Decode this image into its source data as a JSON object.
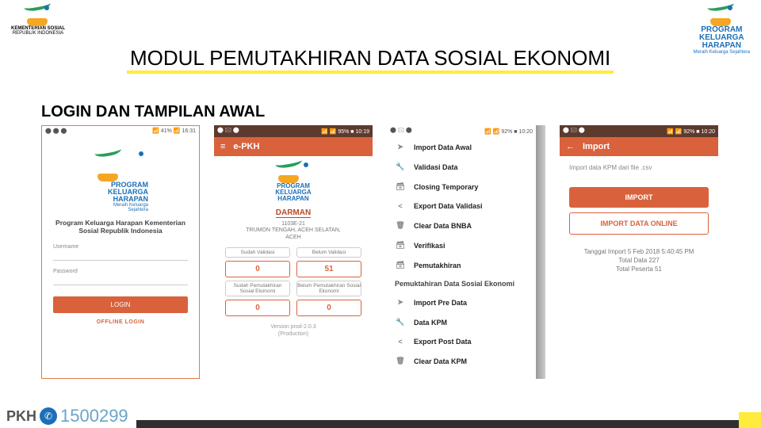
{
  "header": {
    "title": "MODUL PEMUTAKHIRAN DATA SOSIAL EKONOMI",
    "section": "LOGIN DAN TAMPILAN AWAL",
    "left_logo_caption1": "KEMENTERIAN SOSIAL",
    "left_logo_caption2": "REPUBLIK INDONESIA",
    "right_logo_line1": "PROGRAM",
    "right_logo_line2": "KELUARGA",
    "right_logo_line3": "HARAPAN",
    "right_logo_caption": "Meraih Keluarga Sejahtera"
  },
  "screen1": {
    "status_left": "⬤ ⬤ ⬤",
    "status_right": "📶 41% 📶 16:31",
    "logo_line1": "PROGRAM",
    "logo_line2": "KELUARGA",
    "logo_line3": "HARAPAN",
    "logo_caption": "Meraih Keluarga Sejahtera",
    "login_title": "Program Keluarga Harapan Kementerian Sosial Republik Indonesia",
    "username_label": "Username",
    "password_label": "Password",
    "login_btn": "LOGIN",
    "offline_link": "OFFLINE LOGIN"
  },
  "screen2": {
    "status_left": "⬤ 🖂 ⬤",
    "status_right": "📶 📶 95% ■ 10:19",
    "app_title": "e-PKH",
    "user": "DARMAN",
    "loc_code": "1103E-21",
    "loc_name": "TRUMON TENGAH, ACEH SELATAN,",
    "loc_prov": "ACEH",
    "stat_h1": "Sudah Validasi",
    "stat_h2": "Belum Validasi",
    "stat_v1": "0",
    "stat_v2": "51",
    "stat_h3": "Sudah Pemutakhiran Sosial Ekonomi",
    "stat_h4": "Belum Pemutakhiran Sosial Ekonomi",
    "stat_v3": "0",
    "stat_v4": "0",
    "ver1": "Version prod-2.0.3",
    "ver2": "(Production)"
  },
  "screen3": {
    "status_left": "⬤ 🖂 ⬤",
    "status_right": "📶 📶 92% ■ 10:20",
    "items": [
      {
        "icon": "➤",
        "label": "Import Data Awal"
      },
      {
        "icon": "🔧",
        "label": "Validasi Data"
      },
      {
        "icon": "🗃",
        "label": "Closing Temporary"
      },
      {
        "icon": "<",
        "label": "Export Data Validasi"
      },
      {
        "icon": "🗑",
        "label": "Clear Data BNBA"
      },
      {
        "icon": "🗃",
        "label": "Verifikasi"
      },
      {
        "icon": "🗃",
        "label": "Pemutakhiran"
      }
    ],
    "section2": "Pemuktahiran Data Sosial Ekonomi",
    "items2": [
      {
        "icon": "➤",
        "label": "Import Pre Data"
      },
      {
        "icon": "🔧",
        "label": "Data KPM"
      },
      {
        "icon": "<",
        "label": "Export Post Data"
      },
      {
        "icon": "🗑",
        "label": "Clear Data KPM"
      }
    ]
  },
  "screen4": {
    "status_left": "⬤ 🖂 ⬤",
    "status_right": "📶 📶 92% ■ 10:20",
    "app_title": "Import",
    "subtitle": "Import data KPM dari file .csv",
    "btn1": "IMPORT",
    "btn2": "IMPORT DATA ONLINE",
    "status1": "Tanggal Import 5 Feb 2018 5:40:45 PM",
    "status2": "Total Data 227",
    "status3": "Total Peserta 51"
  },
  "footer": {
    "brand": "PKH",
    "phone": "1500299"
  }
}
